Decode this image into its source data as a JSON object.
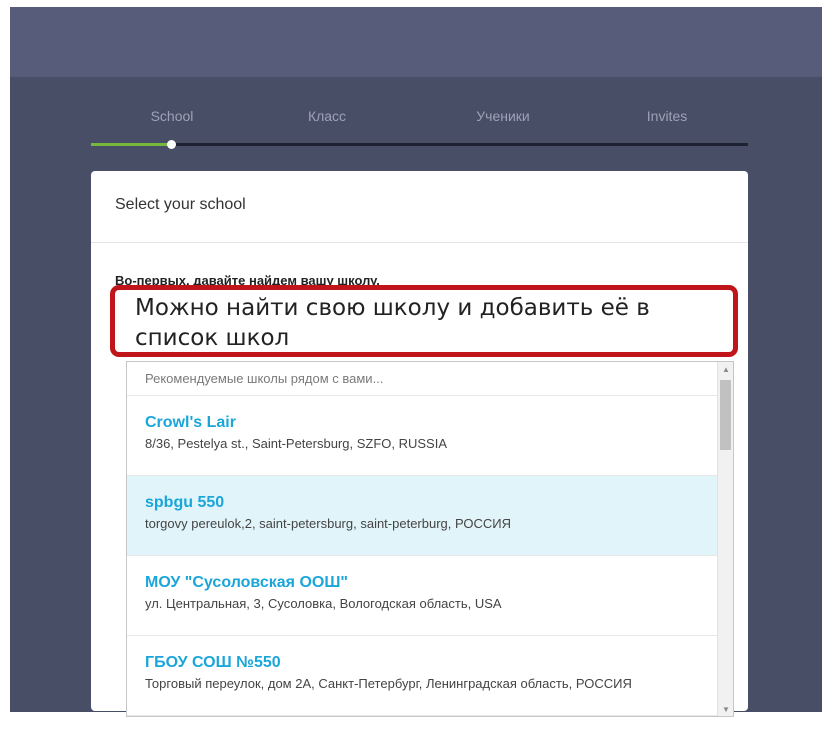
{
  "steps": [
    "School",
    "Класс",
    "Ученики",
    "Invites"
  ],
  "progress": {
    "completed_steps": 1,
    "total_steps": 4,
    "accent": "#76b83b"
  },
  "card": {
    "title": "Select your school",
    "instruction": "Во-первых, давайте найдем вашу школу."
  },
  "annotation": {
    "text": "Можно найти свою школу и добавить её в список школ",
    "border_color": "#c0151b"
  },
  "dropdown": {
    "hint": "Рекомендуемые школы рядом с вами...",
    "items": [
      {
        "name": "Crowl's Lair",
        "address": "8/36, Pestelya st., Saint-Petersburg, SZFO, RUSSIA"
      },
      {
        "name": "spbgu 550",
        "address": "torgovy pereulok,2, saint-petersburg, saint-peterburg, РОССИЯ"
      },
      {
        "name": "МОУ \"Сусоловская ООШ\"",
        "address": "ул. Центральная, 3, Сусоловка, Вологодская область, USA"
      },
      {
        "name": "ГБОУ СОШ №550",
        "address": "Торговый переулок, дом 2А, Санкт-Петербург, Ленинградская область, РОССИЯ"
      }
    ]
  },
  "colors": {
    "link": "#1aa6d9",
    "selected_row": "#e1f4fa"
  },
  "icons": {
    "scroll_up": "chevron-up-icon",
    "scroll_down": "chevron-down-icon"
  }
}
